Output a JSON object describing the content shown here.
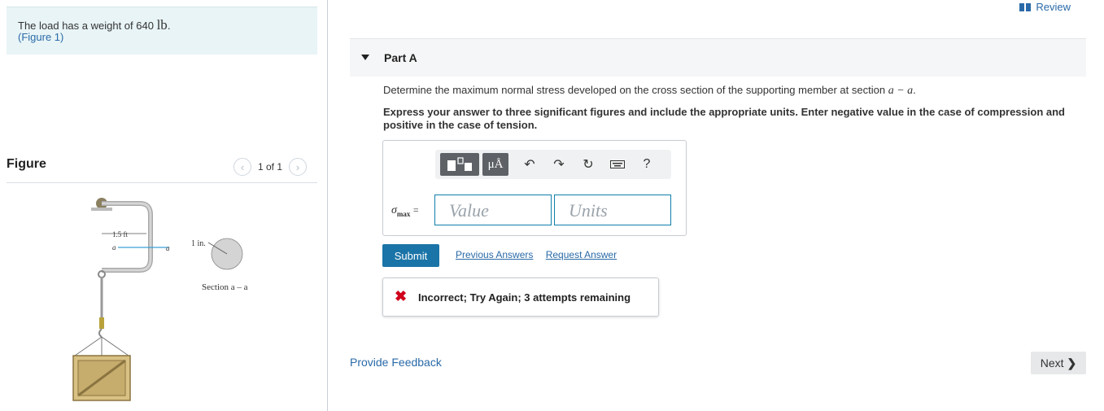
{
  "intro": {
    "weight_text": "The load has a weight of 640",
    "weight_unit": "lb",
    "weight_suffix": ".",
    "figure_link": "(Figure 1)"
  },
  "figure": {
    "label": "Figure",
    "page": "1 of 1",
    "dim_length": "1.5 ft",
    "dim_diameter": "1 in.",
    "section_marker": "a",
    "section_caption": "Section a – a"
  },
  "header": {
    "review_label": "Review"
  },
  "part": {
    "title": "Part A",
    "question": "Determine the maximum normal stress developed on the cross section of the supporting member at section",
    "section_math": "a − a",
    "question_end": ".",
    "instructions": "Express your answer to three significant figures and include the appropriate units. Enter negative value in the case of compression and positive in the case of tension."
  },
  "answer": {
    "var_symbol": "σ",
    "var_sub": "max",
    "equals": "=",
    "value_placeholder": "Value",
    "units_placeholder": "Units",
    "unit_button": "μÅ",
    "help_button": "?"
  },
  "actions": {
    "submit": "Submit",
    "previous_answers": "Previous Answers",
    "request_answer": "Request Answer"
  },
  "feedback": {
    "message": "Incorrect; Try Again; 3 attempts remaining"
  },
  "footer": {
    "provide_feedback": "Provide Feedback",
    "next": "Next"
  },
  "colors": {
    "accent": "#1b74a7",
    "link": "#2a6aa8",
    "error": "#d0021b"
  }
}
